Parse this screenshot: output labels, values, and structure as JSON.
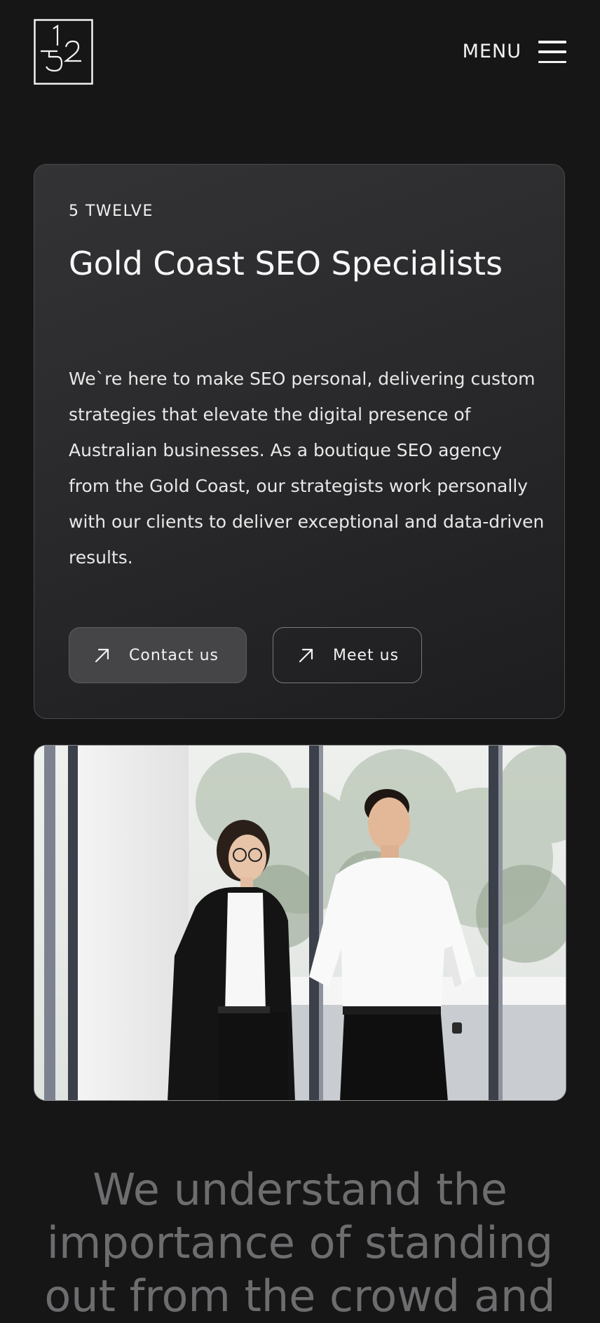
{
  "header": {
    "logo_text": "5 12",
    "menu_label": "MENU"
  },
  "hero": {
    "eyebrow": "5 TWELVE",
    "title": "Gold Coast SEO Specialists",
    "body": "We`re here to make SEO personal, delivering custom strategies that elevate the digital presence of Australian businesses. As a boutique SEO agency from the Gold Coast, our strategists work personally with our clients to deliver exceptional and data-driven results.",
    "buttons": {
      "contact_label": "Contact us",
      "meet_label": "Meet us"
    },
    "icons": {
      "button_icon": "arrow-up-right-icon",
      "menu_icon": "hamburger-icon"
    }
  },
  "photo": {
    "alt": "Two team members standing in an office in front of windows"
  },
  "tagline": {
    "text": "We understand the importance of standing out from the crowd and"
  },
  "colors": {
    "background": "#161617",
    "card_background": "#2a2a2c",
    "text_primary": "#f2f2f2",
    "text_muted": "#6d6d6f",
    "contact_button_bg": "#454547"
  }
}
